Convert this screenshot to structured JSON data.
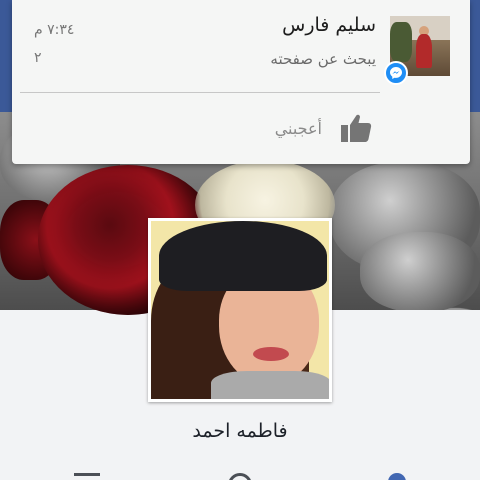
{
  "notification": {
    "sender_name": "سليم فارس",
    "message": "يبحث عن صفحته",
    "time": "٧:٣٤ م",
    "count": "٢",
    "action_label": "أعجبني",
    "badge_color": "#1f8ef5"
  },
  "profile": {
    "name": "فاطمه احمد"
  },
  "colors": {
    "brand": "#3b5998",
    "accent": "#4267b2"
  },
  "icons": {
    "like": "thumbs-up-icon",
    "messenger": "messenger-icon",
    "menu": "menu-icon",
    "globe": "globe-icon",
    "friends": "person-icon"
  }
}
